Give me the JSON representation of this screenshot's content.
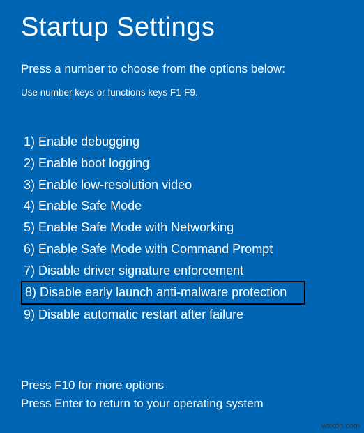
{
  "title": "Startup Settings",
  "subtitle": "Press a number to choose from the options below:",
  "hint": "Use number keys or functions keys F1-F9.",
  "options": [
    {
      "num": "1)",
      "label": "Enable debugging",
      "highlight": false
    },
    {
      "num": "2)",
      "label": "Enable boot logging",
      "highlight": false
    },
    {
      "num": "3)",
      "label": "Enable low-resolution video",
      "highlight": false
    },
    {
      "num": "4)",
      "label": "Enable Safe Mode",
      "highlight": false
    },
    {
      "num": "5)",
      "label": "Enable Safe Mode with Networking",
      "highlight": false
    },
    {
      "num": "6)",
      "label": "Enable Safe Mode with Command Prompt",
      "highlight": false
    },
    {
      "num": "7)",
      "label": "Disable driver signature enforcement",
      "highlight": false
    },
    {
      "num": "8)",
      "label": "Disable early launch anti-malware protection",
      "highlight": true
    },
    {
      "num": "9)",
      "label": "Disable automatic restart after failure",
      "highlight": false
    }
  ],
  "footer": {
    "line1": "Press F10 for more options",
    "line2": "Press Enter to return to your operating system"
  },
  "watermark": "wsxdn.com"
}
